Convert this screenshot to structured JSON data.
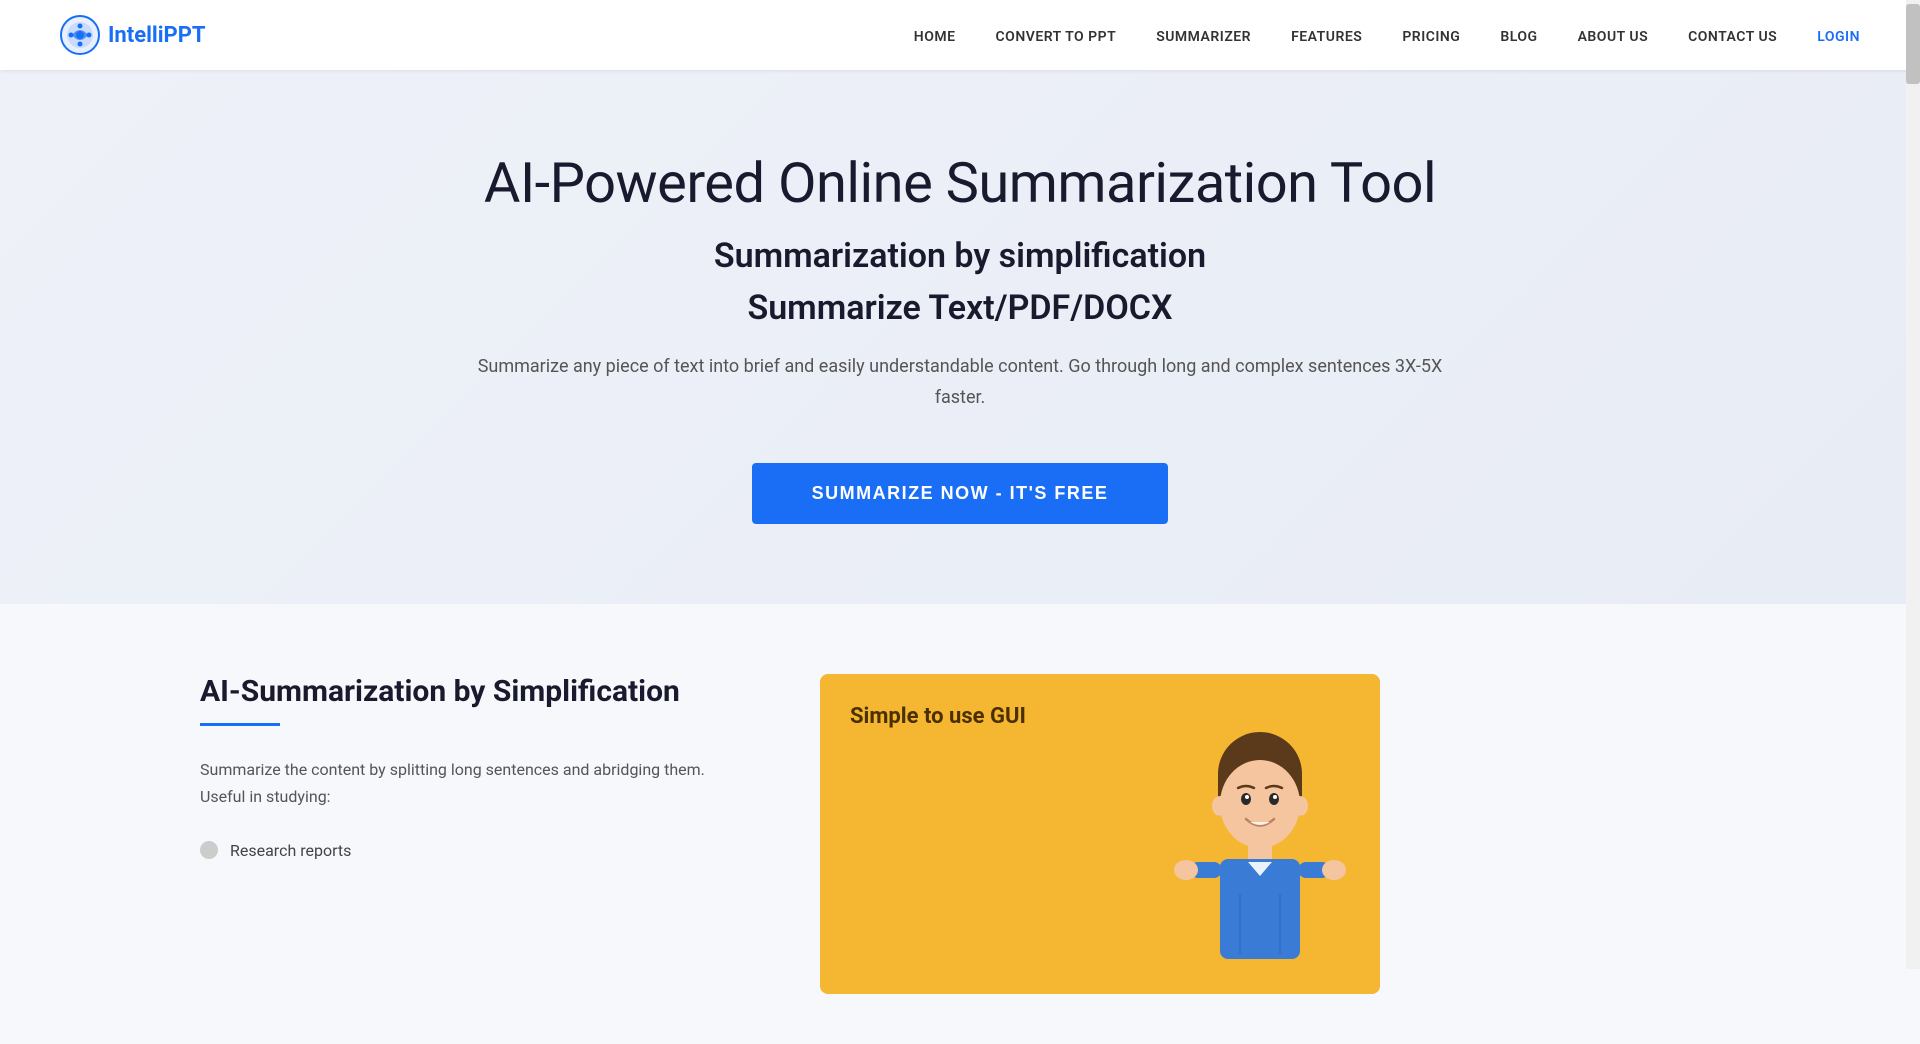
{
  "brand": {
    "name": "IntelliPPT",
    "logo_alt": "IntelliPPT logo"
  },
  "navbar": {
    "items": [
      {
        "label": "HOME",
        "href": "#"
      },
      {
        "label": "CONVERT TO PPT",
        "href": "#"
      },
      {
        "label": "SUMMARIZER",
        "href": "#"
      },
      {
        "label": "FEATURES",
        "href": "#"
      },
      {
        "label": "PRICING",
        "href": "#"
      },
      {
        "label": "BLOG",
        "href": "#"
      },
      {
        "label": "ABOUT US",
        "href": "#"
      },
      {
        "label": "CONTACT US",
        "href": "#"
      },
      {
        "label": "LOGIN",
        "href": "#"
      }
    ]
  },
  "hero": {
    "title": "AI-Powered Online Summarization Tool",
    "subtitle1": "Summarization by simplification",
    "subtitle2": "Summarize Text/PDF/DOCX",
    "description": "Summarize any piece of text into brief and easily understandable content. Go through long and complex sentences 3X-5X faster.",
    "cta_label": "SUMMARIZE NOW - IT'S FREE"
  },
  "features": {
    "title": "AI-Summarization by Simplification",
    "description": "Summarize the content by splitting long sentences and abridging them. Useful in studying:",
    "list": [
      {
        "label": "Research reports"
      }
    ],
    "illustration": {
      "title": "Simple to use GUI"
    }
  },
  "colors": {
    "primary": "#1a6ef5",
    "hero_bg": "#eef1f8",
    "text_dark": "#1a1a2e",
    "text_gray": "#555555",
    "illustration_bg": "#f5b731"
  }
}
